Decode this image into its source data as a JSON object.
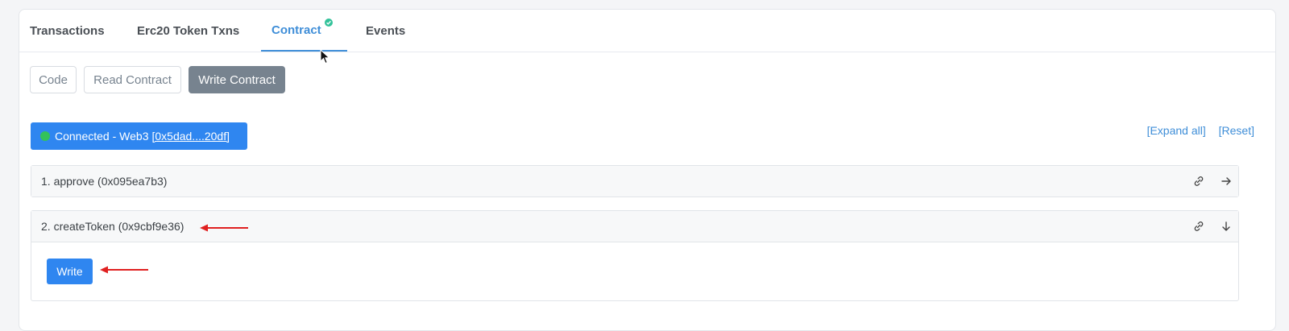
{
  "tabs": [
    {
      "label": "Transactions"
    },
    {
      "label": "Erc20 Token Txns"
    },
    {
      "label": "Contract",
      "verified_icon": "check-circle-icon"
    },
    {
      "label": "Events"
    }
  ],
  "active_tab": "Contract",
  "subtabs": [
    {
      "label": "Code"
    },
    {
      "label": "Read Contract"
    },
    {
      "label": "Write Contract"
    }
  ],
  "active_subtab": "Write Contract",
  "connection": {
    "status": "Connected - Web3",
    "address": "[0x5dad....20df]"
  },
  "links": {
    "expand_all": "[Expand all]",
    "reset": "[Reset]"
  },
  "functions": [
    {
      "label": "1. approve (0x095ea7b3)",
      "expanded": false
    },
    {
      "label": "2. createToken (0x9cbf9e36)",
      "expanded": true,
      "action_label": "Write"
    }
  ],
  "colors": {
    "accent": "#3f8ed8",
    "primary_button": "#2f86f0",
    "annotation_arrow": "#e02020",
    "connected_dot": "#33c25a"
  }
}
